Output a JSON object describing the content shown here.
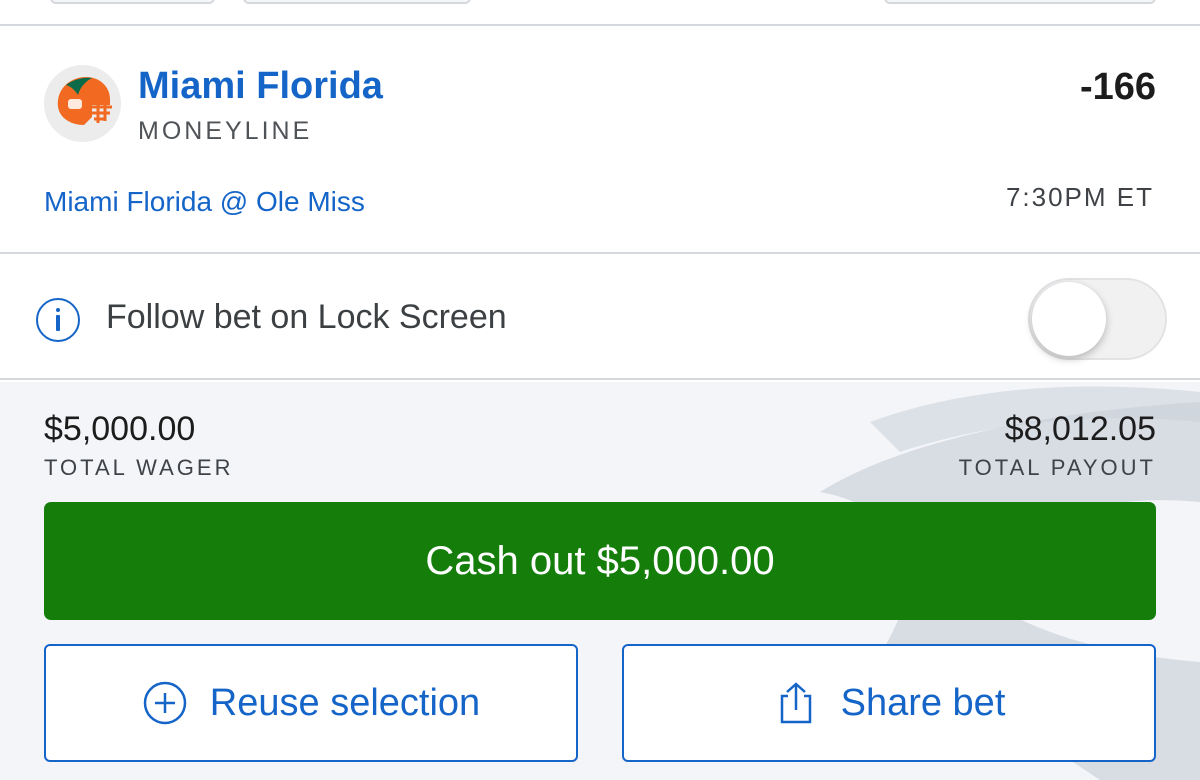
{
  "bet": {
    "team": "Miami Florida",
    "market": "MONEYLINE",
    "odds": "-166",
    "matchup": "Miami Florida @ Ole Miss",
    "time": "7:30PM ET",
    "logo_icon": "football-helmet-icon",
    "colors": {
      "team_blue": "#1565c8",
      "helmet_orange": "#f26a21",
      "helmet_green": "#0b6b49"
    }
  },
  "follow": {
    "label": "Follow bet on Lock Screen",
    "enabled": false
  },
  "summary": {
    "wager_amount": "$5,000.00",
    "wager_label": "TOTAL WAGER",
    "payout_amount": "$8,012.05",
    "payout_label": "TOTAL PAYOUT"
  },
  "actions": {
    "cashout_label": "Cash out $5,000.00",
    "reuse_label": "Reuse selection",
    "share_label": "Share bet",
    "cashout_color": "#157e0b"
  }
}
